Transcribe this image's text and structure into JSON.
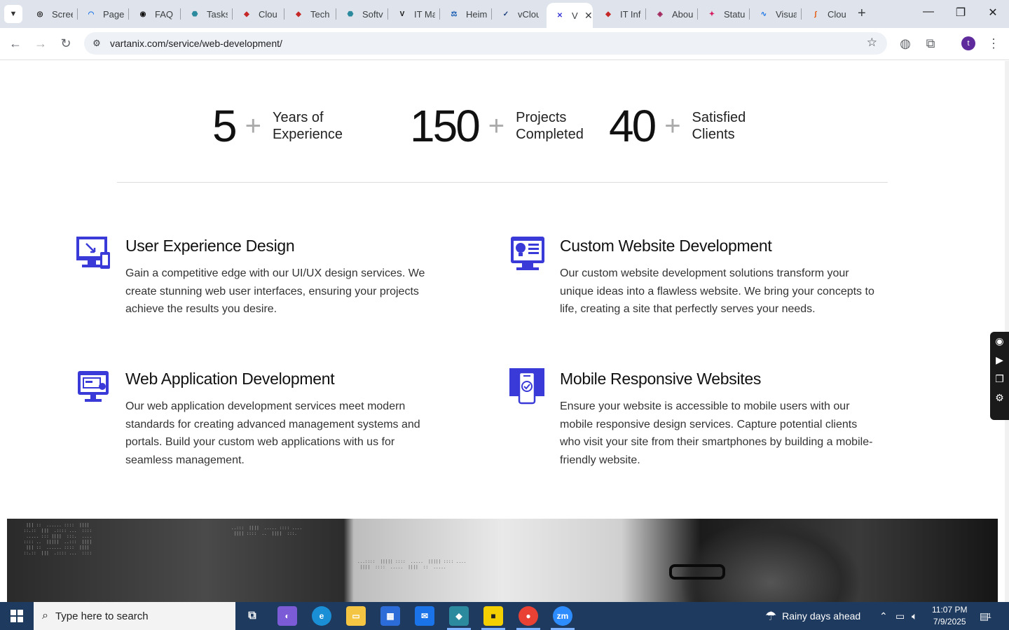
{
  "browser": {
    "tabs": [
      {
        "label": "Scree",
        "fav": "◎",
        "color": "#111"
      },
      {
        "label": "Page",
        "fav": "◠",
        "color": "#1a73e8"
      },
      {
        "label": "FAQ",
        "fav": "◉",
        "color": "#111"
      },
      {
        "label": "Tasks",
        "fav": "⬣",
        "color": "#2b8a9e"
      },
      {
        "label": "Clou",
        "fav": "◆",
        "color": "#c62828"
      },
      {
        "label": "Tech",
        "fav": "◆",
        "color": "#c62828"
      },
      {
        "label": "Softv",
        "fav": "⬣",
        "color": "#2b8a9e"
      },
      {
        "label": "IT Ma",
        "fav": "V",
        "color": "#111"
      },
      {
        "label": "Heim",
        "fav": "⚖",
        "color": "#1a5fb4"
      },
      {
        "label": "vClou",
        "fav": "✓",
        "color": "#1a3d7c"
      },
      {
        "label": "V",
        "fav": "✕",
        "color": "#3a3ad8"
      },
      {
        "label": "IT Inf",
        "fav": "◆",
        "color": "#c62828"
      },
      {
        "label": "Abou",
        "fav": "◈",
        "color": "#a1245a"
      },
      {
        "label": "Statu",
        "fav": "✦",
        "color": "#d81b60"
      },
      {
        "label": "Visua",
        "fav": "∿",
        "color": "#1a73e8"
      },
      {
        "label": "Clou",
        "fav": "∫",
        "color": "#e65100"
      }
    ],
    "url": "vartanix.com/service/web-development/",
    "profile_initial": "t"
  },
  "stats": [
    {
      "number": "5",
      "plus": "+",
      "line1": "Years of",
      "line2": "Experience"
    },
    {
      "number": "150",
      "plus": "+",
      "line1": "Projects",
      "line2": "Completed"
    },
    {
      "number": "40",
      "plus": "+",
      "line1": "Satisfied",
      "line2": "Clients"
    }
  ],
  "services": [
    {
      "title": "User Experience Design",
      "icon": "monitor-cursor-icon",
      "text": "Gain a competitive edge with our UI/UX design services. We create stunning web user interfaces, ensuring your projects achieve the results you desire."
    },
    {
      "title": "Custom Website Development",
      "icon": "website-bulb-icon",
      "text": "Our custom website development solutions transform your unique ideas into a flawless website. We bring your concepts to life, creating a site that perfectly serves your needs."
    },
    {
      "title": "Web Application Development",
      "icon": "web-app-icon",
      "text": "Our web application development services meet modern standards for creating advanced management systems and portals. Build your custom web applications with us for seamless management."
    },
    {
      "title": "Mobile Responsive Websites",
      "icon": "mobile-check-icon",
      "text": "Ensure your website is accessible to mobile users with our mobile responsive design services. Capture potential clients who visit your site from their smartphones by building a mobile-friendly website."
    }
  ],
  "colors": {
    "accent": "#3a3ad8",
    "taskbar": "#1e3a5f"
  },
  "taskbar": {
    "search_placeholder": "Type here to search",
    "weather": "Rainy days ahead",
    "time": "11:07 PM",
    "date": "7/9/2025",
    "notifications": "1"
  }
}
